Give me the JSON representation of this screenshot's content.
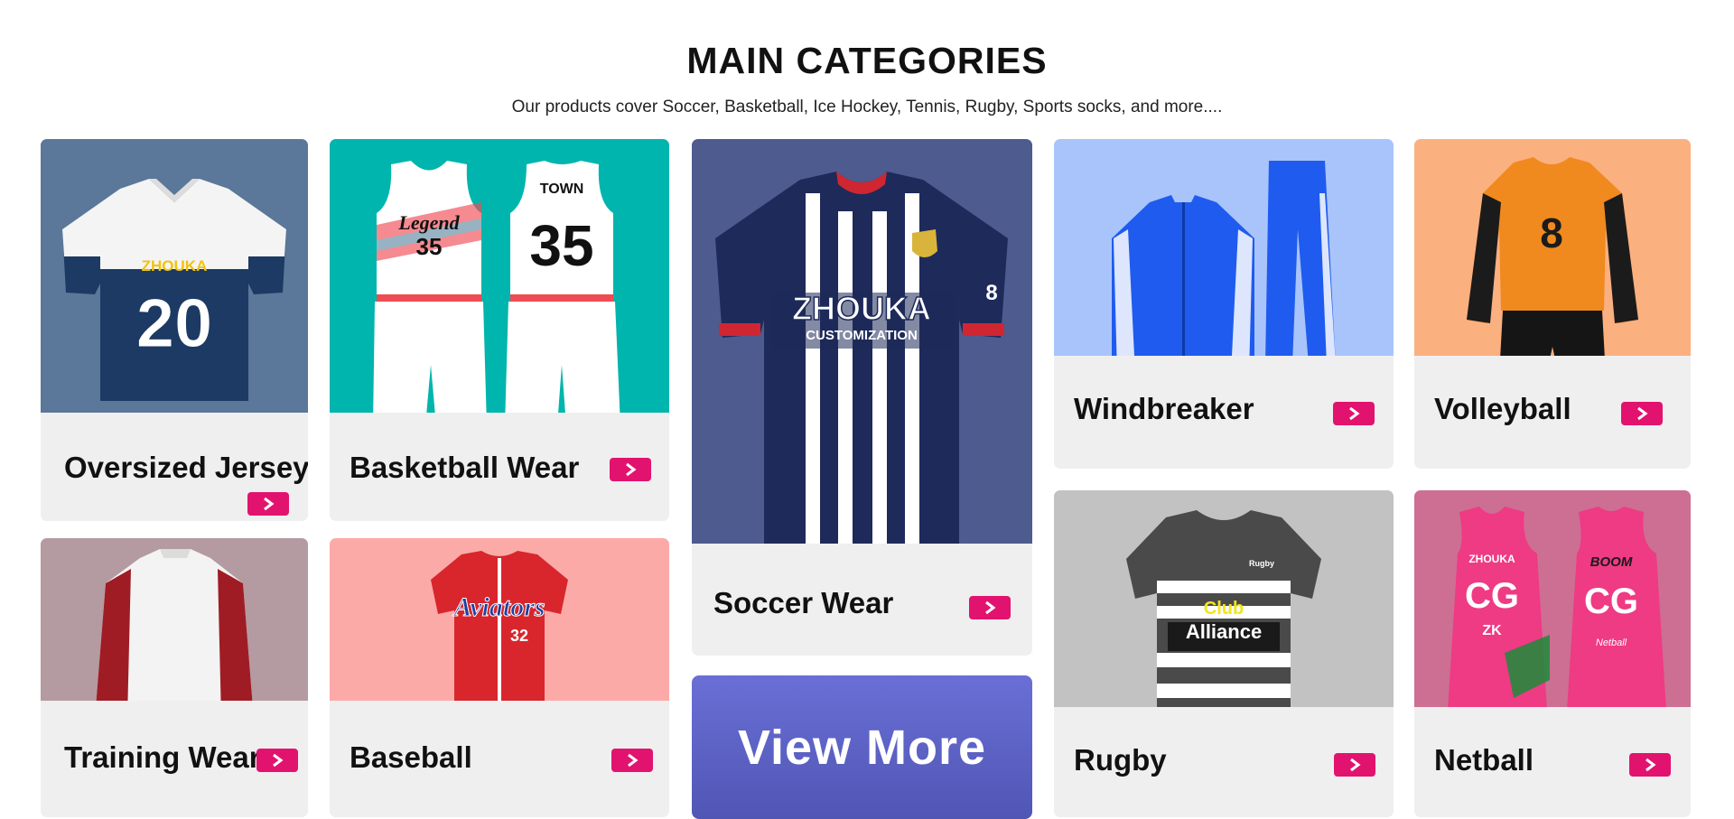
{
  "section": {
    "title": "MAIN CATEGORIES",
    "subtitle": "Our products cover Soccer, Basketball, Ice Hockey, Tennis, Rugby, Sports socks, and more...."
  },
  "categories": [
    {
      "label": "Oversized Jersey",
      "bg_color": "#5b7799"
    },
    {
      "label": "Basketball Wear",
      "bg_color": "#00b5ad"
    },
    {
      "label": "Soccer Wear",
      "bg_color": "#4d5b8f"
    },
    {
      "label": "Windbreaker",
      "bg_color": "#a9c4fb"
    },
    {
      "label": "Volleyball",
      "bg_color": "#fbb080"
    },
    {
      "label": "Training Wear",
      "bg_color": "#b49aa1"
    },
    {
      "label": "Baseball",
      "bg_color": "#fbaaa8"
    },
    {
      "label": "Rugby",
      "bg_color": "#c2c2c2"
    },
    {
      "label": "Netball",
      "bg_color": "#cc6f93"
    }
  ],
  "product_prints": {
    "oversized": {
      "brand": "ZHOUKA",
      "number": "20"
    },
    "basketball": {
      "front_text": "Legend",
      "front_number": "35",
      "back_name": "TOWN",
      "back_number": "35"
    },
    "soccer": {
      "brand": "ZHOUKA",
      "line2": "CUSTOMIZATION",
      "sleeve_number": "8"
    },
    "volleyball": {
      "number": "8"
    },
    "baseball": {
      "script": "Aviators",
      "number": "32"
    },
    "rugby": {
      "line1": "Club",
      "line2": "Alliance",
      "tag": "Rugby"
    },
    "netball": {
      "front_brand": "ZHOUKA",
      "front_code": "CG",
      "front_sub": "ZK",
      "back_code": "CG",
      "back_text": "BOOM",
      "back_sub": "Netball"
    }
  },
  "arrow_icon": "chevron-right-icon",
  "accent_color": "#e2136e",
  "view_more": {
    "label": "View More"
  }
}
